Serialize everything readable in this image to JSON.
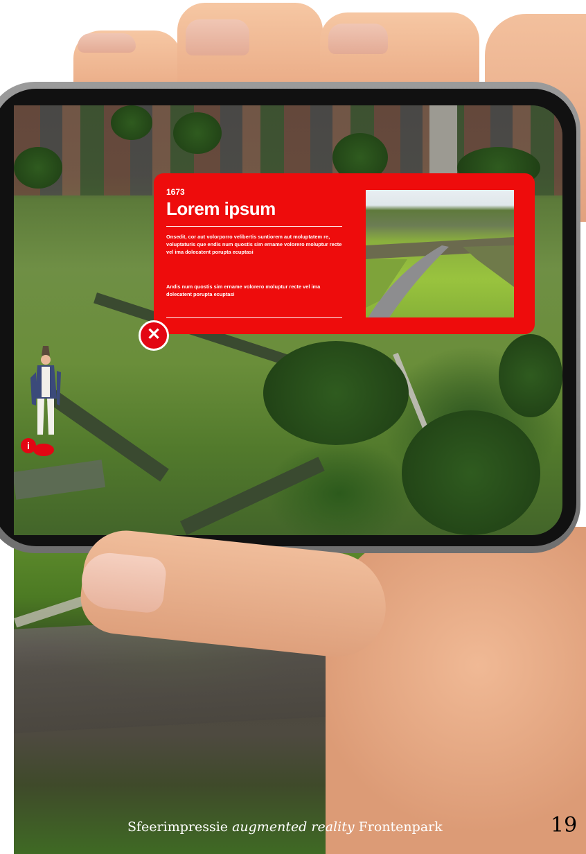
{
  "popup": {
    "year": "1673",
    "title": "Lorem ipsum",
    "paragraph_1": "Onsedit, cor aut volorporro velibertis suntiorem aut moluptatem re, voluptaturis que endis num quostis sim ername volorero moluptur recte vel ima dolecatent porupta ecuptasi",
    "paragraph_2": "Andis num quostis sim ername volorero moluptur recte vel ima dolecatent porupta ecuptasi",
    "close_icon": "close-icon",
    "accent_color": "#ee0c0c"
  },
  "ar_marker": {
    "badge": "i",
    "icon": "info-icon"
  },
  "caption": {
    "prefix": "Sfeerimpressie",
    "emphasis": "augmented reality",
    "suffix": "Frontenpark"
  },
  "page_number": "19"
}
